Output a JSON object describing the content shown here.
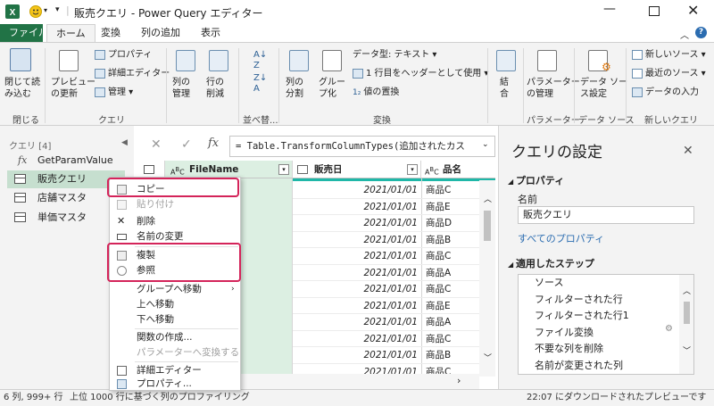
{
  "title": "販売クエリ - Power Query エディター",
  "ribbon_tabs": [
    "ファイル",
    "ホーム",
    "変換",
    "列の追加",
    "表示"
  ],
  "ribbon": {
    "close_group": {
      "btn": "閉じて読\nみ込む",
      "label": "閉じる"
    },
    "query_group": {
      "preview": "プレビュー\nの更新",
      "properties": "プロパティ",
      "advanced": "詳細エディター",
      "manage": "管理",
      "label": "クエリ"
    },
    "columns_group": {
      "choose": "列の\n管理",
      "remove": "行の\n削減"
    },
    "sort_label": "並べ替...",
    "transform_group": {
      "split": "列の\n分割",
      "group": "グルー\nプ化",
      "datatype": "データ型: テキスト",
      "first_row": "1 行目をヘッダーとして使用",
      "replace": "値の置換",
      "label": "変換"
    },
    "combine": "結\n合",
    "params_group": {
      "btn": "パラメーター\nの管理",
      "label": "パラメーター"
    },
    "ds_group": {
      "btn": "データ ソー\nス設定",
      "label": "データ ソース"
    },
    "newq_group": {
      "new_source": "新しいソース",
      "recent": "最近のソース",
      "enter": "データの入力",
      "label": "新しいクエリ"
    }
  },
  "queries": {
    "header": "クエリ [4]",
    "items": [
      "GetParamValue",
      "販売クエリ",
      "店舗マスタ",
      "単価マスタ"
    ]
  },
  "formula": "= Table.TransformColumnTypes(追加されたカス",
  "table": {
    "columns": [
      "FileName",
      "販売日",
      "品名"
    ],
    "rows": [
      [
        "2021/01/01",
        "商品C"
      ],
      [
        "2021/01/01",
        "商品E"
      ],
      [
        "2021/01/01",
        "商品D"
      ],
      [
        "2021/01/01",
        "商品B"
      ],
      [
        "2021/01/01",
        "商品C"
      ],
      [
        "2021/01/01",
        "商品A"
      ],
      [
        "2021/01/01",
        "商品C"
      ],
      [
        "2021/01/01",
        "商品E"
      ],
      [
        "2021/01/01",
        "商品A"
      ],
      [
        "2021/01/01",
        "商品C"
      ],
      [
        "2021/01/01",
        "商品B"
      ],
      [
        "2021/01/01",
        "商品C"
      ]
    ]
  },
  "settings": {
    "title": "クエリの設定",
    "properties_header": "プロパティ",
    "name_label": "名前",
    "name_value": "販売クエリ",
    "all_props": "すべてのプロパティ",
    "steps_header": "適用したステップ",
    "steps": [
      "ソース",
      "フィルターされた行",
      "フィルターされた行1",
      "ファイル変換",
      "不要な列を削除",
      "名前が変更された列"
    ]
  },
  "context_menu": {
    "items": [
      "コピー",
      "貼り付け",
      "削除",
      "名前の変更",
      "複製",
      "参照",
      "グループへ移動",
      "上へ移動",
      "下へ移動",
      "関数の作成...",
      "パラメーターへ変換する",
      "詳細エディター",
      "プロパティ..."
    ]
  },
  "status": {
    "left": "6 列, 999+ 行",
    "middle": "上位 1000 行に基づく列のプロファイリング",
    "right": "22:07 にダウンロードされたプレビューです"
  }
}
